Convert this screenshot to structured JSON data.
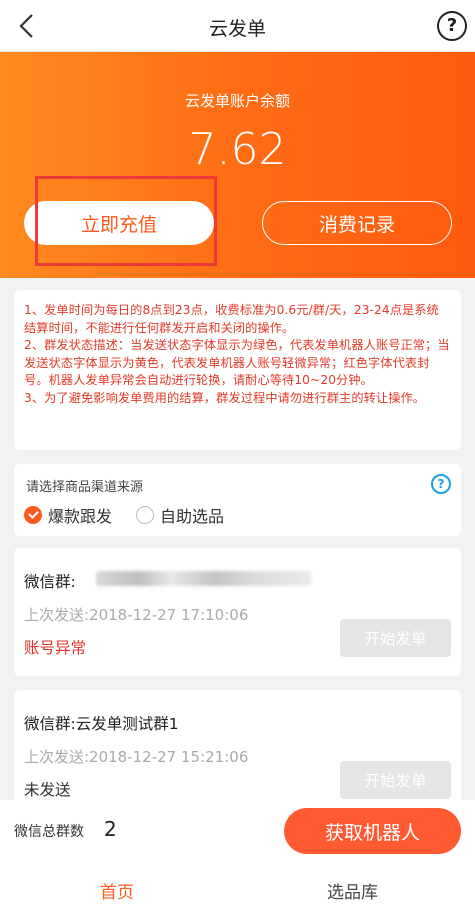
{
  "nav": {
    "title": "云发单",
    "help_symbol": "?"
  },
  "balance": {
    "label": "云发单账户余额",
    "value": "7.62",
    "recharge_label": "立即充值",
    "records_label": "消费记录"
  },
  "notice": {
    "paragraphs": [
      "1、发单时间为每日的8点到23点，收费标准为0.6元/群/天，23-24点是系统结算时间，不能进行任何群发开启和关闭的操作。",
      "2、群发状态描述：当发送状态字体显示为绿色，代表发单机器人账号正常；当发送状态字体显示为黄色，代表发单机器人账号轻微异常；红色字体代表封号。机器人发单异常会自动进行轮换，请耐心等待10~20分钟。",
      "3、为了避免影响发单费用的结算，群发过程中请勿进行群主的转让操作。"
    ]
  },
  "source": {
    "title": "请选择商品渠道来源",
    "help_symbol": "?",
    "options": [
      {
        "label": "爆款跟发",
        "checked": true
      },
      {
        "label": "自助选品",
        "checked": false
      }
    ]
  },
  "groups": [
    {
      "name": "微信群:",
      "last_sent": "上次发送:2018-12-27 17:10:06",
      "status": "账号异常",
      "status_color": "#e0312a",
      "button_label": "开始发单"
    },
    {
      "name": "微信群:云发单测试群1",
      "last_sent": "上次发送:2018-12-27 15:21:06",
      "status": "未发送",
      "status_color": "#333333",
      "button_label": "开始发单"
    }
  ],
  "footer": {
    "total_label": "微信总群数",
    "total_value": "2",
    "robot_button_label": "获取机器人"
  },
  "tabs": [
    {
      "label": "首页",
      "active": true
    },
    {
      "label": "选品库",
      "active": false
    }
  ],
  "colors": {
    "accent": "#ff5a1f",
    "header_gradient_start": "#ff8a1f",
    "header_gradient_end": "#ff5a10",
    "notice_text": "#e23a2a",
    "highlight_box": "#ec3a3a"
  }
}
